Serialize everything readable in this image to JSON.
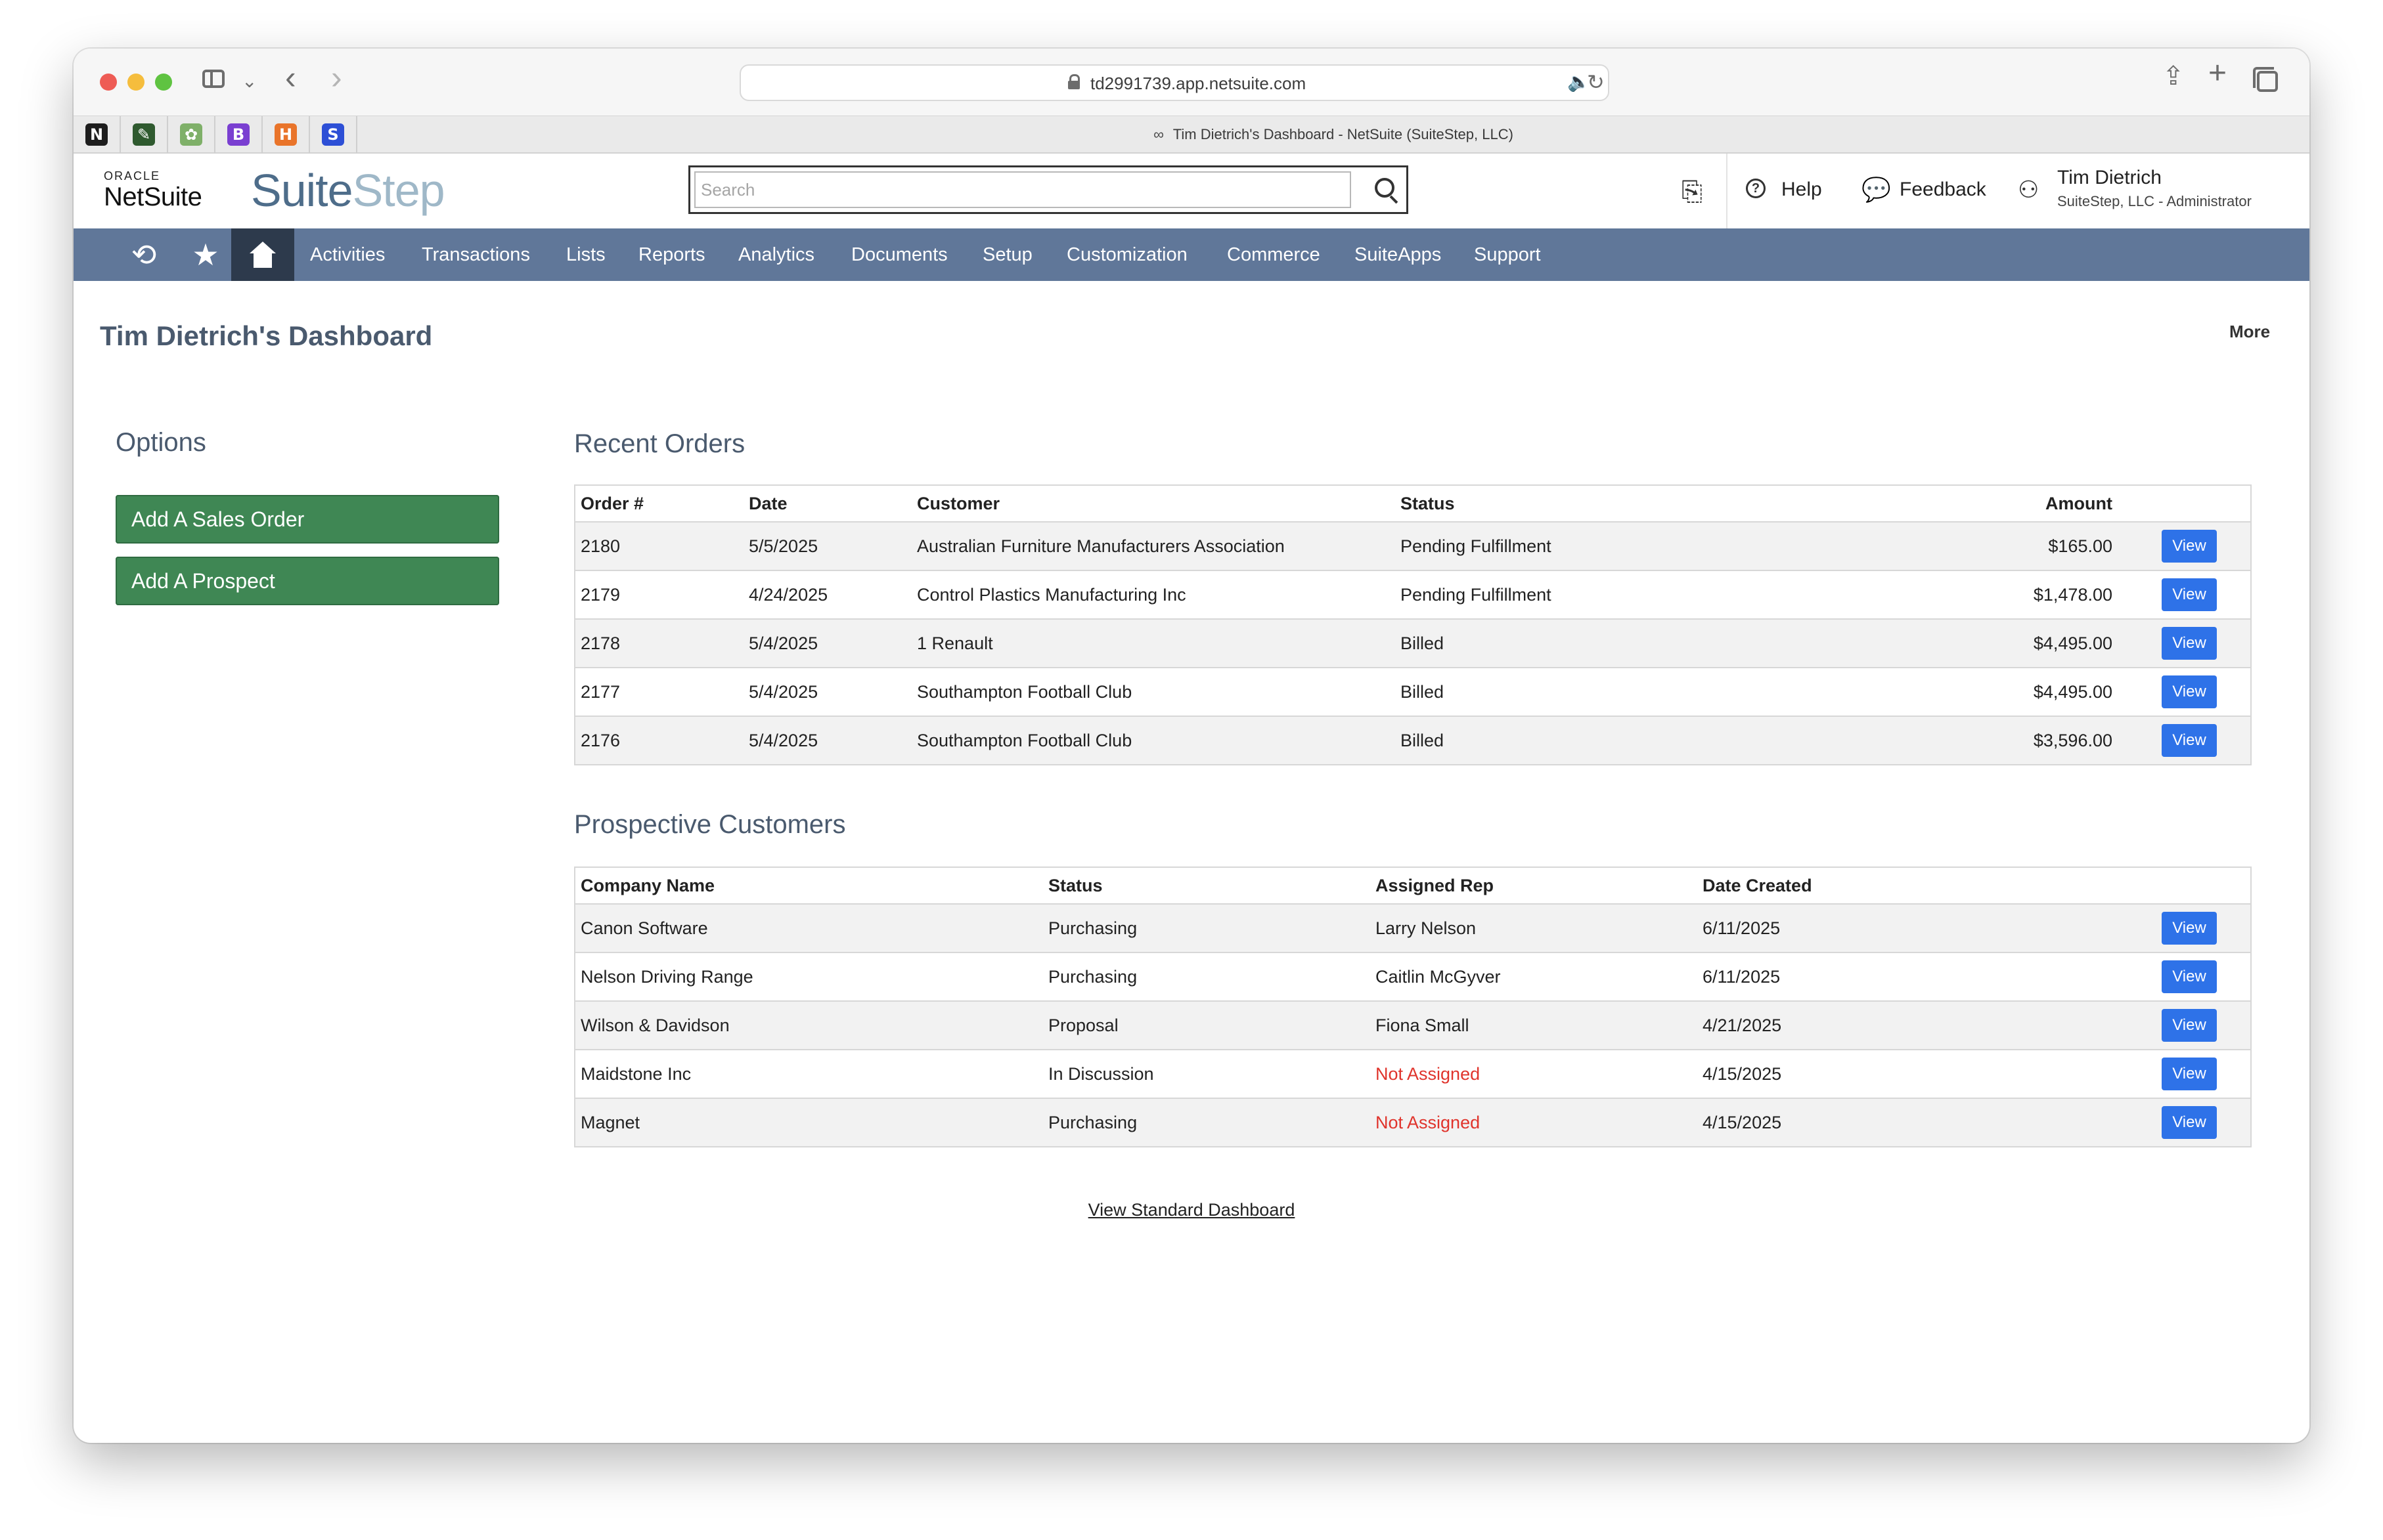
{
  "browser": {
    "url": "td2991739.app.netsuite.com",
    "tab_title": "Tim Dietrich's Dashboard - NetSuite (SuiteStep, LLC)",
    "pinned_tabs": [
      {
        "letter": "N",
        "color": "#1d1d1d",
        "icon": "notion-icon"
      },
      {
        "letter": "✎",
        "color": "#2f5a2f",
        "icon": "chat-icon"
      },
      {
        "letter": "✿",
        "color": "#7fb069",
        "icon": "extension-icon"
      },
      {
        "letter": "B",
        "color": "#7a3fd1",
        "icon": "b-icon"
      },
      {
        "letter": "H",
        "color": "#e9742a",
        "icon": "h-icon"
      },
      {
        "letter": "S",
        "color": "#2d4fd6",
        "icon": "s-icon"
      }
    ]
  },
  "header": {
    "oracle": "ORACLE",
    "netsuite": "NetSuite",
    "logo_suite": "Suite",
    "logo_step": "Step",
    "search_placeholder": "Search",
    "help": "Help",
    "feedback": "Feedback",
    "user_name": "Tim Dietrich",
    "user_role": "SuiteStep, LLC - Administrator"
  },
  "nav": {
    "items": [
      "Activities",
      "Transactions",
      "Lists",
      "Reports",
      "Analytics",
      "Documents",
      "Setup",
      "Customization",
      "Commerce",
      "SuiteApps",
      "Support"
    ]
  },
  "page": {
    "title": "Tim Dietrich's Dashboard",
    "more": "More",
    "options_heading": "Options",
    "add_sales_order": "Add A Sales Order",
    "add_prospect": "Add A Prospect",
    "recent_orders_heading": "Recent Orders",
    "prospects_heading": "Prospective Customers",
    "view_standard_dashboard": "View Standard Dashboard",
    "view_label": "View"
  },
  "orders": {
    "columns": [
      "Order #",
      "Date",
      "Customer",
      "Status",
      "Amount"
    ],
    "rows": [
      {
        "order": "2180",
        "date": "5/5/2025",
        "customer": "Australian Furniture Manufacturers Association",
        "status": "Pending Fulfillment",
        "amount": "$165.00"
      },
      {
        "order": "2179",
        "date": "4/24/2025",
        "customer": "Control Plastics Manufacturing Inc",
        "status": "Pending Fulfillment",
        "amount": "$1,478.00"
      },
      {
        "order": "2178",
        "date": "5/4/2025",
        "customer": "1 Renault",
        "status": "Billed",
        "amount": "$4,495.00"
      },
      {
        "order": "2177",
        "date": "5/4/2025",
        "customer": "Southampton Football Club",
        "status": "Billed",
        "amount": "$4,495.00"
      },
      {
        "order": "2176",
        "date": "5/4/2025",
        "customer": "Southampton Football Club",
        "status": "Billed",
        "amount": "$3,596.00"
      }
    ]
  },
  "prospects": {
    "columns": [
      "Company Name",
      "Status",
      "Assigned Rep",
      "Date Created"
    ],
    "rows": [
      {
        "company": "Canon Software",
        "status": "Purchasing",
        "rep": "Larry Nelson",
        "date": "6/11/2025"
      },
      {
        "company": "Nelson Driving Range",
        "status": "Purchasing",
        "rep": "Caitlin McGyver",
        "date": "6/11/2025"
      },
      {
        "company": "Wilson & Davidson",
        "status": "Proposal",
        "rep": "Fiona Small",
        "date": "4/21/2025"
      },
      {
        "company": "Maidstone Inc",
        "status": "In Discussion",
        "rep": "Not Assigned",
        "date": "4/15/2025"
      },
      {
        "company": "Magnet",
        "status": "Purchasing",
        "rep": "Not Assigned",
        "date": "4/15/2025"
      }
    ]
  },
  "colors": {
    "nav_bg": "#607799",
    "nav_active": "#2d3a4c",
    "green_button": "#3f8754",
    "view_button": "#2e72e8",
    "warning_text": "#e0342c"
  }
}
